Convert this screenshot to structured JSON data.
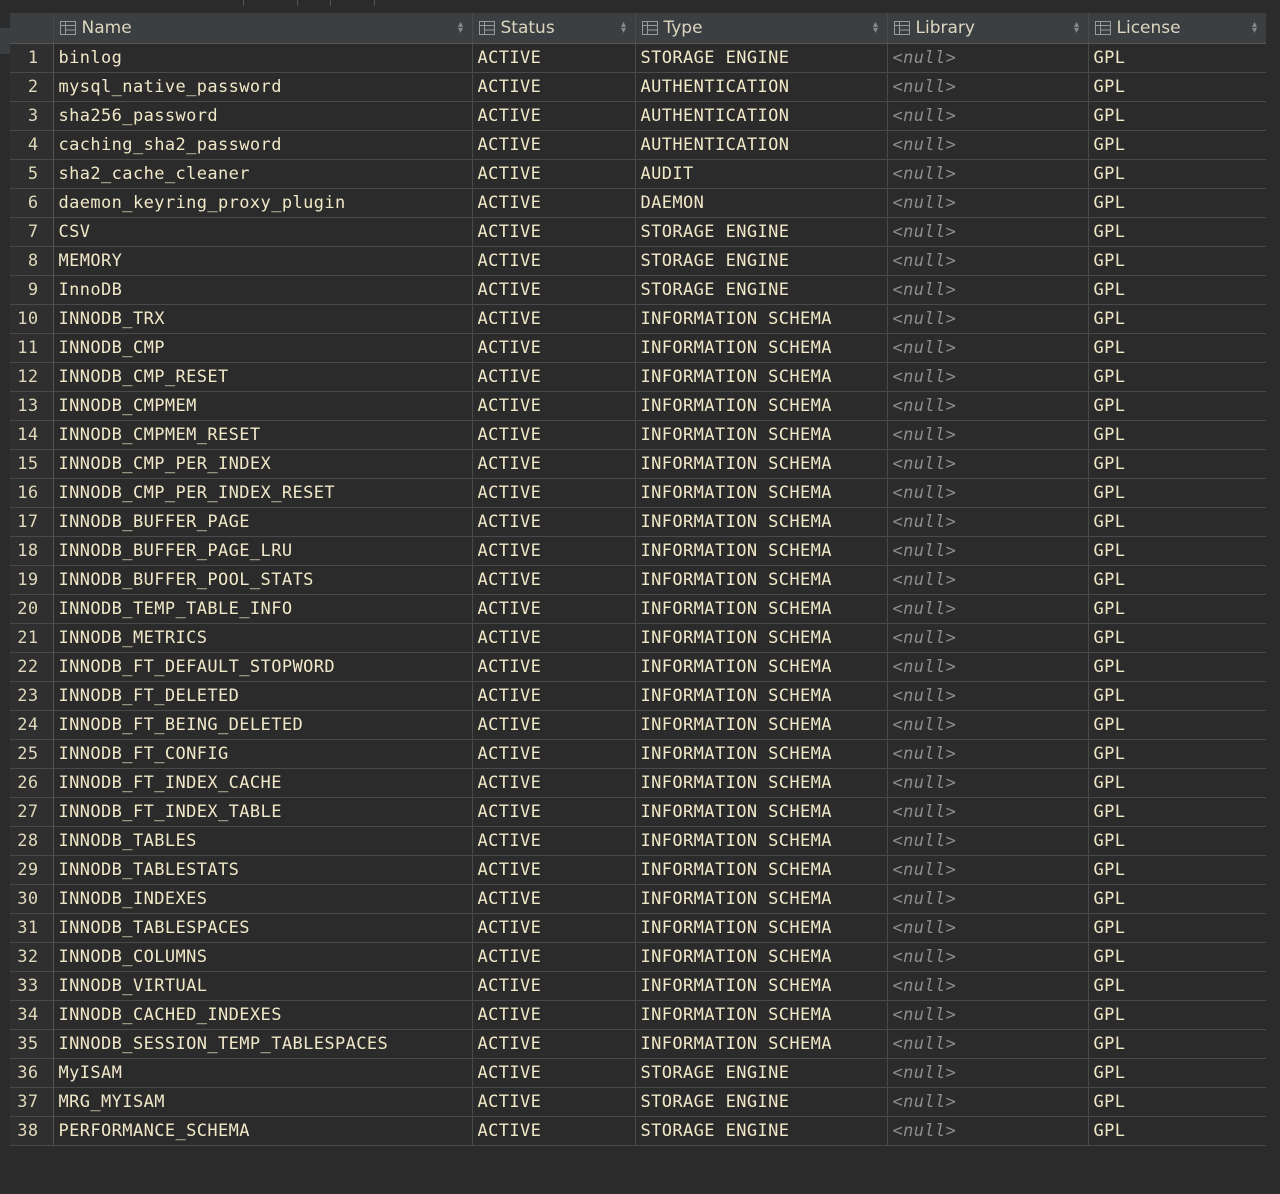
{
  "columns": [
    "Name",
    "Status",
    "Type",
    "Library",
    "License"
  ],
  "rows": [
    {
      "n": "1",
      "name": "binlog",
      "status": "ACTIVE",
      "type": "STORAGE ENGINE",
      "library": "<null>",
      "license": "GPL"
    },
    {
      "n": "2",
      "name": "mysql_native_password",
      "status": "ACTIVE",
      "type": "AUTHENTICATION",
      "library": "<null>",
      "license": "GPL"
    },
    {
      "n": "3",
      "name": "sha256_password",
      "status": "ACTIVE",
      "type": "AUTHENTICATION",
      "library": "<null>",
      "license": "GPL"
    },
    {
      "n": "4",
      "name": "caching_sha2_password",
      "status": "ACTIVE",
      "type": "AUTHENTICATION",
      "library": "<null>",
      "license": "GPL"
    },
    {
      "n": "5",
      "name": "sha2_cache_cleaner",
      "status": "ACTIVE",
      "type": "AUDIT",
      "library": "<null>",
      "license": "GPL"
    },
    {
      "n": "6",
      "name": "daemon_keyring_proxy_plugin",
      "status": "ACTIVE",
      "type": "DAEMON",
      "library": "<null>",
      "license": "GPL"
    },
    {
      "n": "7",
      "name": "CSV",
      "status": "ACTIVE",
      "type": "STORAGE ENGINE",
      "library": "<null>",
      "license": "GPL"
    },
    {
      "n": "8",
      "name": "MEMORY",
      "status": "ACTIVE",
      "type": "STORAGE ENGINE",
      "library": "<null>",
      "license": "GPL"
    },
    {
      "n": "9",
      "name": "InnoDB",
      "status": "ACTIVE",
      "type": "STORAGE ENGINE",
      "library": "<null>",
      "license": "GPL"
    },
    {
      "n": "10",
      "name": "INNODB_TRX",
      "status": "ACTIVE",
      "type": "INFORMATION SCHEMA",
      "library": "<null>",
      "license": "GPL"
    },
    {
      "n": "11",
      "name": "INNODB_CMP",
      "status": "ACTIVE",
      "type": "INFORMATION SCHEMA",
      "library": "<null>",
      "license": "GPL"
    },
    {
      "n": "12",
      "name": "INNODB_CMP_RESET",
      "status": "ACTIVE",
      "type": "INFORMATION SCHEMA",
      "library": "<null>",
      "license": "GPL"
    },
    {
      "n": "13",
      "name": "INNODB_CMPMEM",
      "status": "ACTIVE",
      "type": "INFORMATION SCHEMA",
      "library": "<null>",
      "license": "GPL"
    },
    {
      "n": "14",
      "name": "INNODB_CMPMEM_RESET",
      "status": "ACTIVE",
      "type": "INFORMATION SCHEMA",
      "library": "<null>",
      "license": "GPL"
    },
    {
      "n": "15",
      "name": "INNODB_CMP_PER_INDEX",
      "status": "ACTIVE",
      "type": "INFORMATION SCHEMA",
      "library": "<null>",
      "license": "GPL"
    },
    {
      "n": "16",
      "name": "INNODB_CMP_PER_INDEX_RESET",
      "status": "ACTIVE",
      "type": "INFORMATION SCHEMA",
      "library": "<null>",
      "license": "GPL"
    },
    {
      "n": "17",
      "name": "INNODB_BUFFER_PAGE",
      "status": "ACTIVE",
      "type": "INFORMATION SCHEMA",
      "library": "<null>",
      "license": "GPL"
    },
    {
      "n": "18",
      "name": "INNODB_BUFFER_PAGE_LRU",
      "status": "ACTIVE",
      "type": "INFORMATION SCHEMA",
      "library": "<null>",
      "license": "GPL"
    },
    {
      "n": "19",
      "name": "INNODB_BUFFER_POOL_STATS",
      "status": "ACTIVE",
      "type": "INFORMATION SCHEMA",
      "library": "<null>",
      "license": "GPL"
    },
    {
      "n": "20",
      "name": "INNODB_TEMP_TABLE_INFO",
      "status": "ACTIVE",
      "type": "INFORMATION SCHEMA",
      "library": "<null>",
      "license": "GPL"
    },
    {
      "n": "21",
      "name": "INNODB_METRICS",
      "status": "ACTIVE",
      "type": "INFORMATION SCHEMA",
      "library": "<null>",
      "license": "GPL"
    },
    {
      "n": "22",
      "name": "INNODB_FT_DEFAULT_STOPWORD",
      "status": "ACTIVE",
      "type": "INFORMATION SCHEMA",
      "library": "<null>",
      "license": "GPL"
    },
    {
      "n": "23",
      "name": "INNODB_FT_DELETED",
      "status": "ACTIVE",
      "type": "INFORMATION SCHEMA",
      "library": "<null>",
      "license": "GPL"
    },
    {
      "n": "24",
      "name": "INNODB_FT_BEING_DELETED",
      "status": "ACTIVE",
      "type": "INFORMATION SCHEMA",
      "library": "<null>",
      "license": "GPL"
    },
    {
      "n": "25",
      "name": "INNODB_FT_CONFIG",
      "status": "ACTIVE",
      "type": "INFORMATION SCHEMA",
      "library": "<null>",
      "license": "GPL"
    },
    {
      "n": "26",
      "name": "INNODB_FT_INDEX_CACHE",
      "status": "ACTIVE",
      "type": "INFORMATION SCHEMA",
      "library": "<null>",
      "license": "GPL"
    },
    {
      "n": "27",
      "name": "INNODB_FT_INDEX_TABLE",
      "status": "ACTIVE",
      "type": "INFORMATION SCHEMA",
      "library": "<null>",
      "license": "GPL"
    },
    {
      "n": "28",
      "name": "INNODB_TABLES",
      "status": "ACTIVE",
      "type": "INFORMATION SCHEMA",
      "library": "<null>",
      "license": "GPL"
    },
    {
      "n": "29",
      "name": "INNODB_TABLESTATS",
      "status": "ACTIVE",
      "type": "INFORMATION SCHEMA",
      "library": "<null>",
      "license": "GPL"
    },
    {
      "n": "30",
      "name": "INNODB_INDEXES",
      "status": "ACTIVE",
      "type": "INFORMATION SCHEMA",
      "library": "<null>",
      "license": "GPL"
    },
    {
      "n": "31",
      "name": "INNODB_TABLESPACES",
      "status": "ACTIVE",
      "type": "INFORMATION SCHEMA",
      "library": "<null>",
      "license": "GPL"
    },
    {
      "n": "32",
      "name": "INNODB_COLUMNS",
      "status": "ACTIVE",
      "type": "INFORMATION SCHEMA",
      "library": "<null>",
      "license": "GPL"
    },
    {
      "n": "33",
      "name": "INNODB_VIRTUAL",
      "status": "ACTIVE",
      "type": "INFORMATION SCHEMA",
      "library": "<null>",
      "license": "GPL"
    },
    {
      "n": "34",
      "name": "INNODB_CACHED_INDEXES",
      "status": "ACTIVE",
      "type": "INFORMATION SCHEMA",
      "library": "<null>",
      "license": "GPL"
    },
    {
      "n": "35",
      "name": "INNODB_SESSION_TEMP_TABLESPACES",
      "status": "ACTIVE",
      "type": "INFORMATION SCHEMA",
      "library": "<null>",
      "license": "GPL"
    },
    {
      "n": "36",
      "name": "MyISAM",
      "status": "ACTIVE",
      "type": "STORAGE ENGINE",
      "library": "<null>",
      "license": "GPL"
    },
    {
      "n": "37",
      "name": "MRG_MYISAM",
      "status": "ACTIVE",
      "type": "STORAGE ENGINE",
      "library": "<null>",
      "license": "GPL"
    },
    {
      "n": "38",
      "name": "PERFORMANCE_SCHEMA",
      "status": "ACTIVE",
      "type": "STORAGE ENGINE",
      "library": "<null>",
      "license": "GPL"
    }
  ],
  "colors": {
    "background": "#2b2b2b",
    "header": "#3c3f41",
    "text": "#f0e8c8",
    "null_text": "#8d8d8d",
    "grid_line": "#4a4a4a"
  }
}
